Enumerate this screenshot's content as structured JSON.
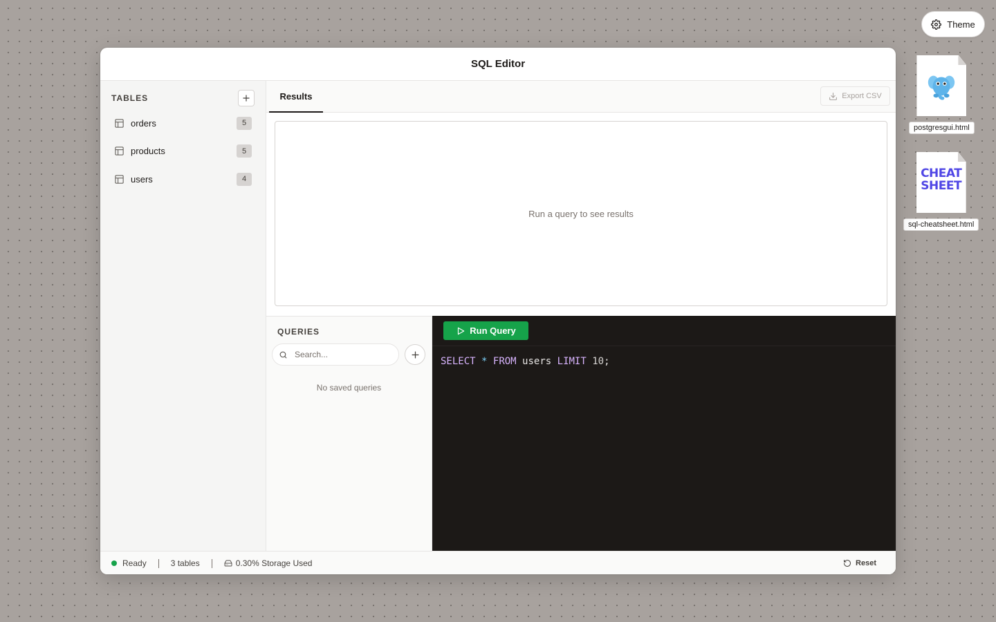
{
  "theme_button": {
    "label": "Theme",
    "icon": "gear-icon"
  },
  "desktop_files": [
    {
      "label": "postgresgui.html",
      "icon": "elephant-icon"
    },
    {
      "label": "sql-cheatsheet.html",
      "icon": "cheatsheet-icon",
      "logo_text": "CHEAT SHEET"
    }
  ],
  "window": {
    "title": "SQL Editor"
  },
  "sidebar": {
    "section_title": "TABLES",
    "tables": [
      {
        "name": "orders",
        "count": "5"
      },
      {
        "name": "products",
        "count": "5"
      },
      {
        "name": "users",
        "count": "4"
      }
    ]
  },
  "results": {
    "tab_label": "Results",
    "export_label": "Export CSV",
    "empty_message": "Run a query to see results"
  },
  "queries": {
    "section_title": "QUERIES",
    "search_placeholder": "Search...",
    "empty_message": "No saved queries"
  },
  "editor": {
    "run_label": "Run Query",
    "code_tokens": {
      "select": "SELECT",
      "star": "*",
      "from": "FROM",
      "table": "users",
      "limit": "LIMIT",
      "num": "10",
      "semi": ";"
    }
  },
  "status": {
    "state": "Ready",
    "tables": "3 tables",
    "storage": "0.30% Storage Used",
    "reset_label": "Reset"
  },
  "colors": {
    "accent": "#16a34a",
    "editor_bg": "#1c1917",
    "keyword": "#d8b4fe",
    "operator": "#7dd3fc"
  }
}
